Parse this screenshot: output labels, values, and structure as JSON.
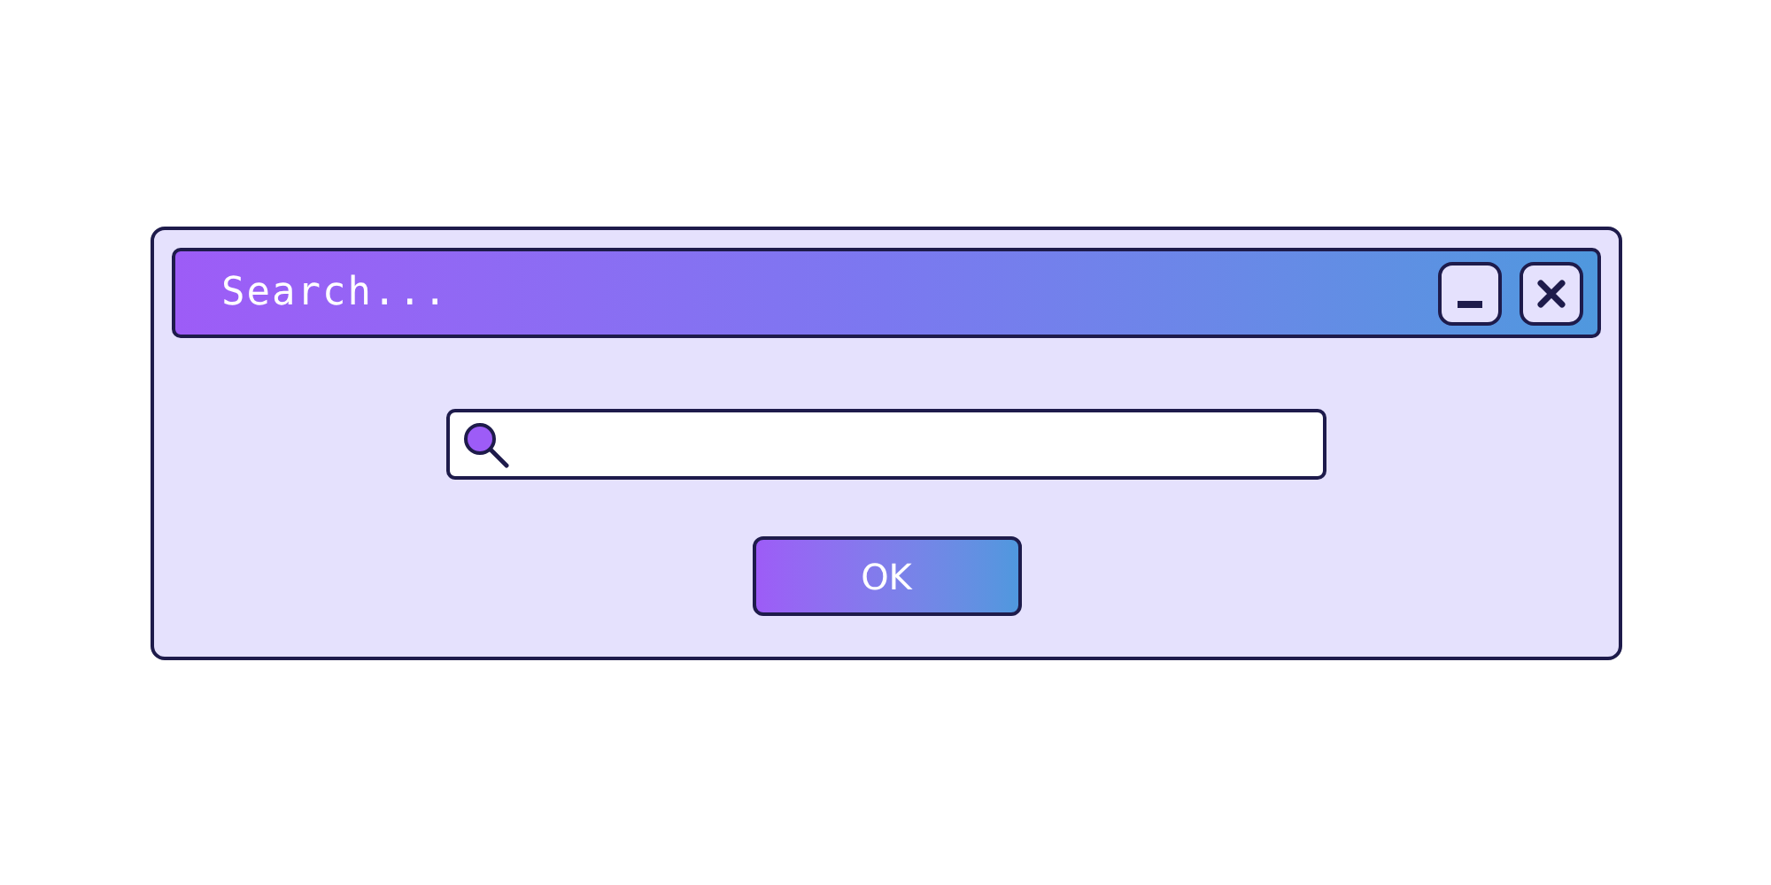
{
  "window": {
    "title": "Search..."
  },
  "buttons": [
    "OK"
  ]
}
